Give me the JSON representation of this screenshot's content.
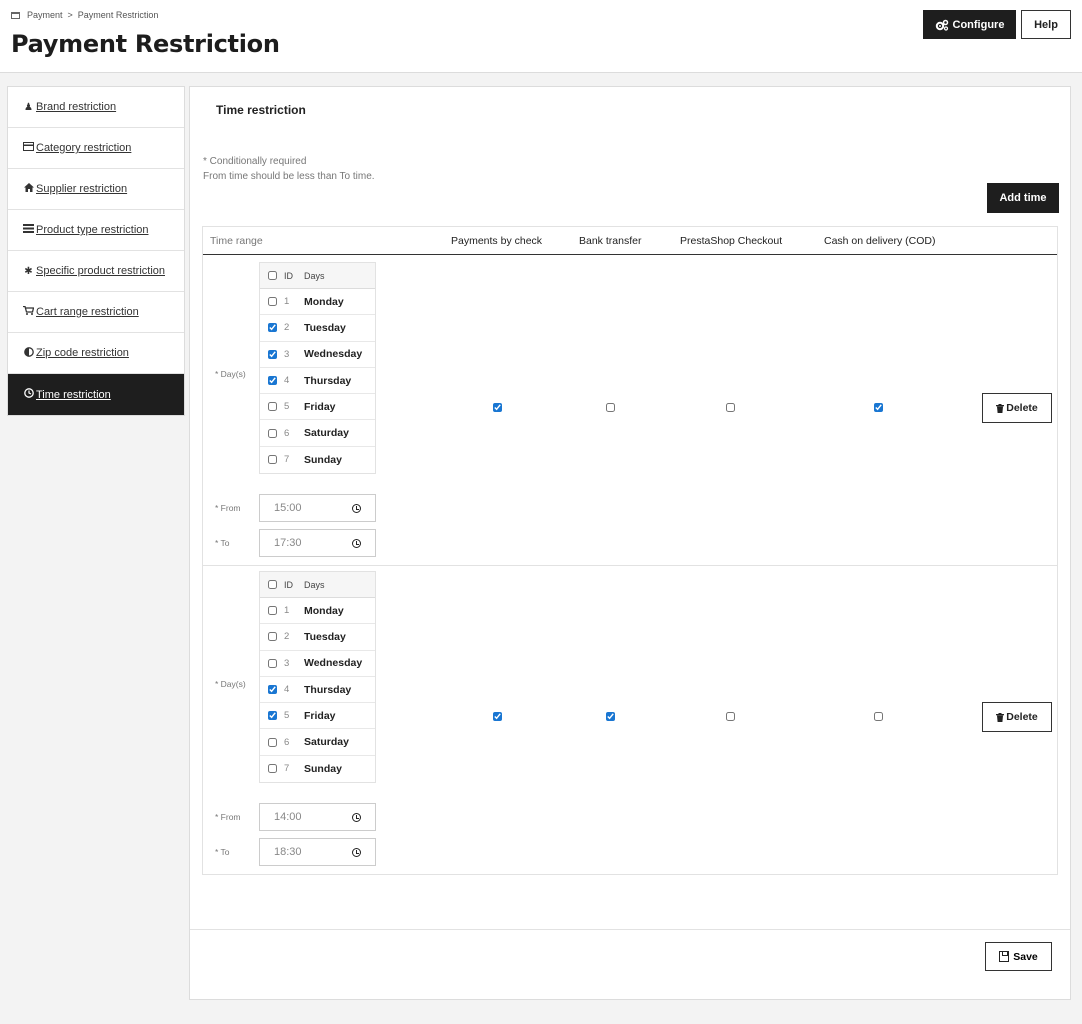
{
  "breadcrumb": {
    "parent": "Payment",
    "separator": ">",
    "current": "Payment Restriction"
  },
  "page": {
    "title": "Payment Restriction"
  },
  "toolbar": {
    "configure_label": "Configure",
    "help_label": "Help"
  },
  "sidebar": {
    "items": [
      {
        "label": "Brand restriction",
        "icon": "user-icon",
        "active": false
      },
      {
        "label": "Category restriction",
        "icon": "credit-card-icon",
        "active": false
      },
      {
        "label": "Supplier restriction",
        "icon": "home-icon",
        "active": false
      },
      {
        "label": "Product type restriction",
        "icon": "list-icon",
        "active": false
      },
      {
        "label": "Specific product restriction",
        "icon": "asterisk-icon",
        "active": false
      },
      {
        "label": "Cart range restriction",
        "icon": "cart-icon",
        "active": false
      },
      {
        "label": "Zip code restriction",
        "icon": "adjust-icon",
        "active": false
      },
      {
        "label": "Time restriction",
        "icon": "clock-icon",
        "active": true
      }
    ]
  },
  "panel": {
    "title": "Time restriction",
    "note_line1": "* Conditionally required",
    "note_line2": "From time should be less than To time.",
    "add_time_label": "Add time",
    "save_label": "Save"
  },
  "table": {
    "headers": {
      "time_range": "Time range",
      "check": "Payments by check",
      "bank": "Bank transfer",
      "prestashop": "PrestaShop Checkout",
      "cod": "Cash on delivery (COD)"
    },
    "days_header": {
      "id": "ID",
      "days": "Days"
    },
    "labels": {
      "days": "* Day(s)",
      "from": "* From",
      "to": "* To"
    },
    "delete_label": "Delete",
    "rows": [
      {
        "days": [
          {
            "id": "1",
            "name": "Monday",
            "checked": false
          },
          {
            "id": "2",
            "name": "Tuesday",
            "checked": true
          },
          {
            "id": "3",
            "name": "Wednesday",
            "checked": true
          },
          {
            "id": "4",
            "name": "Thursday",
            "checked": true
          },
          {
            "id": "5",
            "name": "Friday",
            "checked": false
          },
          {
            "id": "6",
            "name": "Saturday",
            "checked": false
          },
          {
            "id": "7",
            "name": "Sunday",
            "checked": false
          }
        ],
        "from": "15:00",
        "to": "17:30",
        "payments": {
          "check": true,
          "bank": false,
          "prestashop": false,
          "cod": true
        }
      },
      {
        "days": [
          {
            "id": "1",
            "name": "Monday",
            "checked": false
          },
          {
            "id": "2",
            "name": "Tuesday",
            "checked": false
          },
          {
            "id": "3",
            "name": "Wednesday",
            "checked": false
          },
          {
            "id": "4",
            "name": "Thursday",
            "checked": true
          },
          {
            "id": "5",
            "name": "Friday",
            "checked": true
          },
          {
            "id": "6",
            "name": "Saturday",
            "checked": false
          },
          {
            "id": "7",
            "name": "Sunday",
            "checked": false
          }
        ],
        "from": "14:00",
        "to": "18:30",
        "payments": {
          "check": true,
          "bank": true,
          "prestashop": false,
          "cod": false
        }
      }
    ]
  },
  "colors": {
    "dark_button": "#1e1e1e",
    "checkbox_accent": "#1976d2",
    "background": "#f3f3f3"
  }
}
